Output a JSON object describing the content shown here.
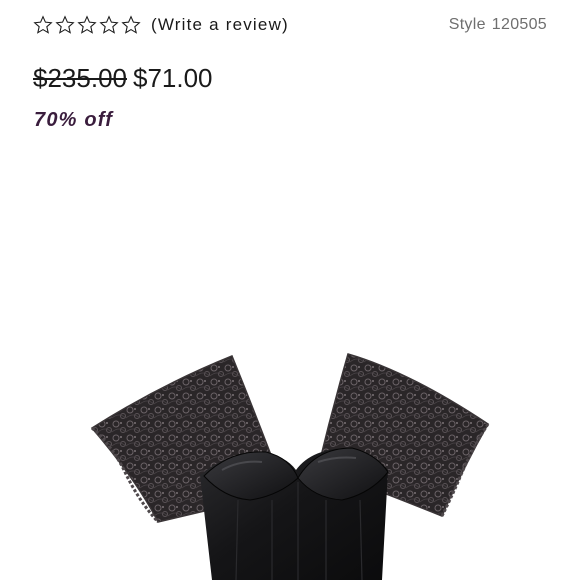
{
  "rating": {
    "stars": [
      {
        "icon": "star-outline-icon"
      },
      {
        "icon": "star-outline-icon"
      },
      {
        "icon": "star-outline-icon"
      },
      {
        "icon": "star-outline-icon"
      },
      {
        "icon": "star-outline-icon"
      }
    ],
    "review_link": "(Write a review)"
  },
  "product": {
    "style_label": "Style",
    "style_number": "120505",
    "original_price": "$235.00",
    "sale_price": "$71.00",
    "discount": "70% off"
  },
  "colors": {
    "discount": "#3a1d3d",
    "muted_text": "#6f6f6f"
  }
}
